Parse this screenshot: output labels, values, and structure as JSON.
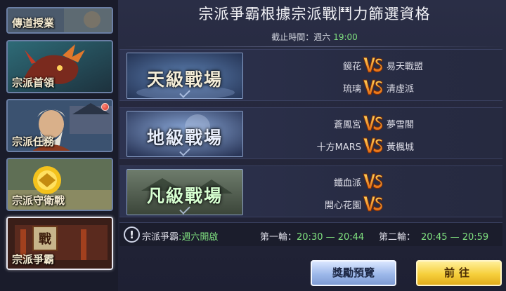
{
  "sidebar": {
    "items": [
      {
        "label": "傳道授業"
      },
      {
        "label": "宗派首領"
      },
      {
        "label": "宗派任務"
      },
      {
        "label": "宗派守衛戰"
      },
      {
        "label": "宗派爭霸",
        "plaque": "戰"
      }
    ]
  },
  "header": {
    "title": "宗派爭霸根據宗派戰鬥力篩選資格",
    "deadline_label": "截止時間：週六",
    "deadline_time": "19:00"
  },
  "arenas": [
    {
      "name": "天級戰場",
      "color": "#f3ecd7",
      "matches": [
        {
          "left": "鏡花",
          "right": "易天戰盟"
        },
        {
          "left": "琉璃",
          "right": "清虛派"
        }
      ]
    },
    {
      "name": "地級戰場",
      "color": "#e8eefc",
      "matches": [
        {
          "left": "蒼鳳宮",
          "right": "夢雪閣"
        },
        {
          "left": "十方MARS",
          "right": "黃楓城"
        }
      ]
    },
    {
      "name": "凡級戰場",
      "color": "#d6ffd0",
      "matches": [
        {
          "left": "鐵血派",
          "right": ""
        },
        {
          "left": "開心花園",
          "right": ""
        }
      ]
    }
  ],
  "info_bar": {
    "icon": "exclamation-icon",
    "label": "宗派爭霸",
    "open": ":週六開啟",
    "round1_label": "第一輪：",
    "round1_time": "20:30 — 20:44",
    "round2_label": "第二輪：",
    "round2_time": "20:45 — 20:59"
  },
  "buttons": {
    "preview": "獎勵預覽",
    "go": "前往"
  },
  "colors": {
    "accent_green": "#7fe07f",
    "vs_orange": "#f39a1e",
    "button_blue": "#9db8ea",
    "button_gold": "#f6cf3c"
  }
}
